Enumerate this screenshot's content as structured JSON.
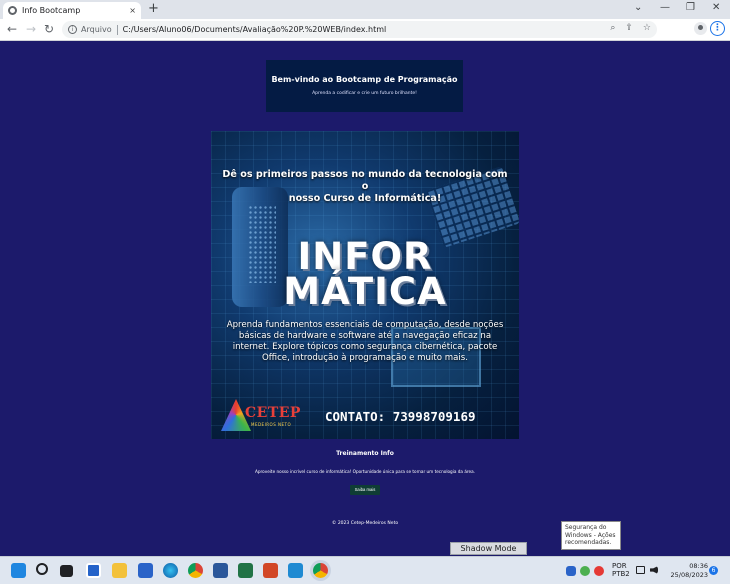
{
  "browser": {
    "tab_title": "Info Bootcamp",
    "tab_close": "×",
    "new_tab": "+",
    "win_dropdown": "⌄",
    "win_min": "—",
    "win_max": "❐",
    "win_close": "✕",
    "back": "←",
    "forward": "→",
    "reload": "↻",
    "info": "i",
    "site_label": "Arquivo",
    "url": "C:/Users/Aluno06/Documents/Avaliação%20P.%20WEB/index.html",
    "zoom_icon": "⌕",
    "share_icon": "⇪",
    "star_icon": "☆",
    "menu": "⋮"
  },
  "page": {
    "header_title": "Bem-vindo ao Bootcamp de Programação",
    "header_subtitle": "Aprenda a codificar e crie um futuro brilhante!",
    "banner": {
      "tagline_1": "Dê os primeiros passos no mundo da tecnologia com o",
      "tagline_2": "nosso Curso de Informática!",
      "title_1": "INFOR",
      "title_2": "MÁTICA",
      "description": "Aprenda fundamentos essenciais de computação, desde noções básicas de hardware e software até a navegação eficaz na internet. Explore tópicos como segurança cibernética, pacote Office, introdução à programação e muito mais.",
      "logo_text": "CETEP",
      "logo_sub": "MEDEIROS NETO",
      "contact": "CONTATO: 73998709169"
    },
    "training_title": "Treinamento Info",
    "training_desc": "Aproveite nosso incrível curso de informática! Oportunidade única para se tornar um tecnologia da área.",
    "button_label": "Saiba mais",
    "footer": "© 2023 Cetep-Medeiros Neto"
  },
  "overlays": {
    "shadow_mode": "Shadow Mode",
    "security_toast": "Segurança do Windows - Ações recomendadas."
  },
  "taskbar": {
    "lang_1": "POR",
    "lang_2": "PTB2",
    "time": "08:36",
    "date": "25/08/2023",
    "notifications": "6",
    "icons": [
      "windows-start",
      "search",
      "task-view",
      "widgets",
      "file-explorer",
      "store",
      "edge",
      "chrome",
      "word",
      "excel",
      "powerpoint",
      "vscode",
      "chrome-active"
    ]
  },
  "colors": {
    "page_bg": "#1c1a6b",
    "header_bg": "#041b44",
    "button_bg": "#0f3d35",
    "accent": "#1a73e8"
  }
}
